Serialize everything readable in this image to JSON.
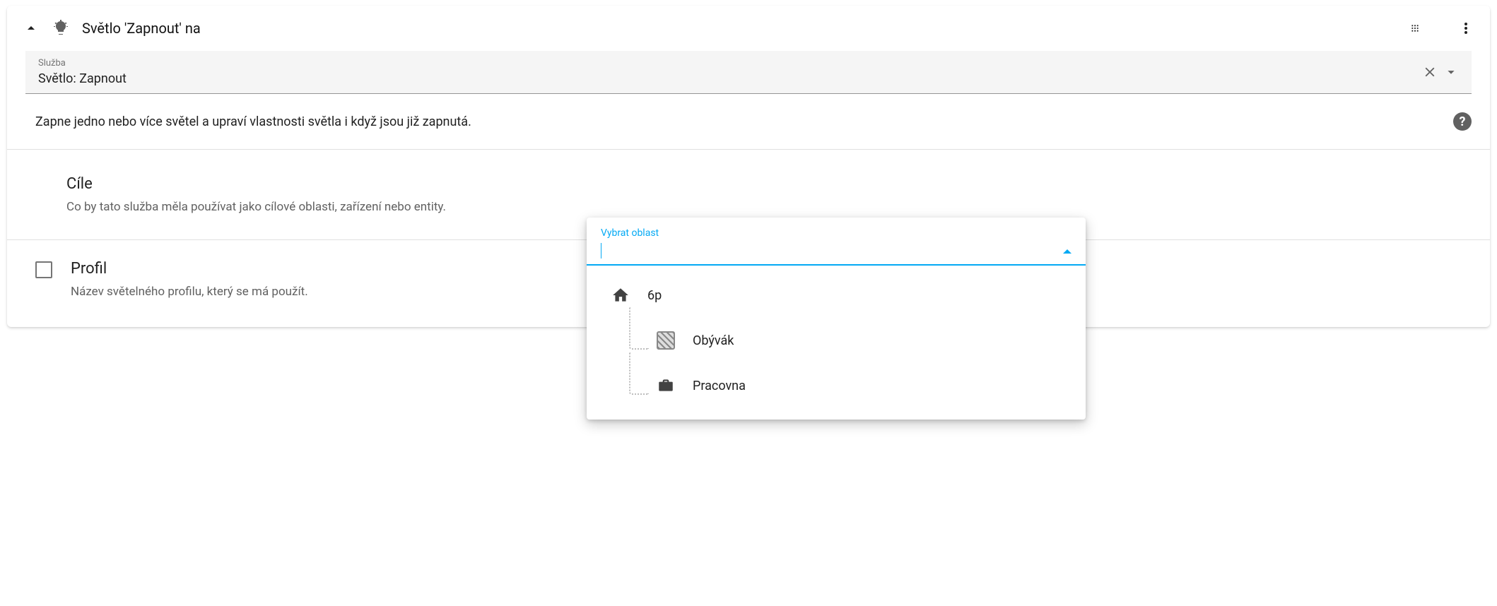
{
  "header": {
    "title": "Světlo 'Zapnout' na"
  },
  "service": {
    "label": "Služba",
    "value": "Světlo: Zapnout"
  },
  "description": "Zapne jedno nebo více světel a upraví vlastnosti světla i když jsou již zapnutá.",
  "targets": {
    "title": "Cíle",
    "subtitle": "Co by tato služba měla používat jako cílové oblasti, zařízení nebo entity."
  },
  "profile": {
    "title": "Profil",
    "subtitle": "Název světelného profilu, který se má použít."
  },
  "area_picker": {
    "label": "Vybrat oblast",
    "root": "6p",
    "children": [
      "Obývák",
      "Pracovna"
    ]
  }
}
